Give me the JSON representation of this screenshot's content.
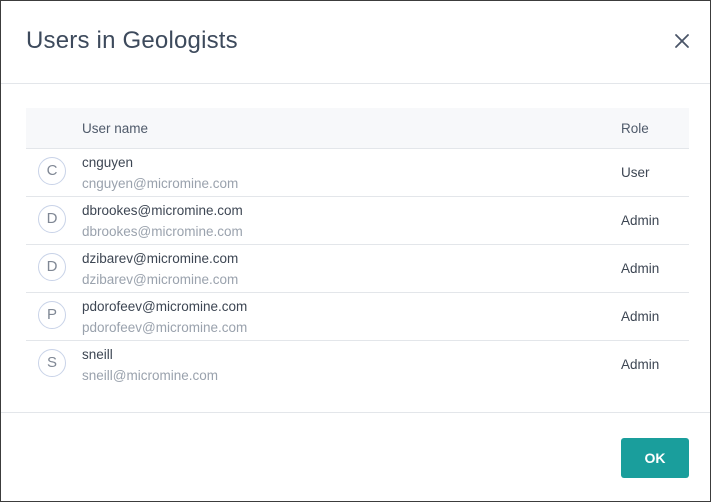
{
  "dialog": {
    "title": "Users in Geologists",
    "close_icon": "close-icon",
    "ok_label": "OK",
    "accent_color": "#1a9e9c"
  },
  "table": {
    "columns": [
      "User name",
      "Role"
    ],
    "rows": [
      {
        "initial": "C",
        "name": "cnguyen",
        "email": "cnguyen@micromine.com",
        "role": "User"
      },
      {
        "initial": "D",
        "name": "dbrookes@micromine.com",
        "email": "dbrookes@micromine.com",
        "role": "Admin"
      },
      {
        "initial": "D",
        "name": "dzibarev@micromine.com",
        "email": "dzibarev@micromine.com",
        "role": "Admin"
      },
      {
        "initial": "P",
        "name": "pdorofeev@micromine.com",
        "email": "pdorofeev@micromine.com",
        "role": "Admin"
      },
      {
        "initial": "S",
        "name": "sneill",
        "email": "sneill@micromine.com",
        "role": "Admin"
      }
    ]
  }
}
